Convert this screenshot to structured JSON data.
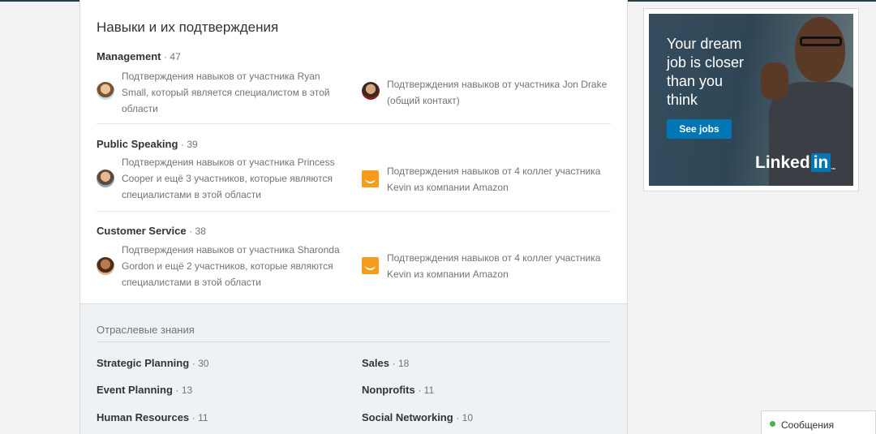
{
  "section": {
    "title": "Навыки и их подтверждения"
  },
  "skills": [
    {
      "name": "Management",
      "count": "· 47",
      "endorsements": [
        {
          "icon": "avatar",
          "lines": [
            "Подтверждения навыков от участника Ryan",
            "Small, который является специалистом в этой",
            "области"
          ]
        },
        {
          "icon": "avatar",
          "lines": [
            "Подтверждения навыков от участника Jon Drake",
            "(общий контакт)"
          ]
        }
      ]
    },
    {
      "name": "Public Speaking",
      "count": "· 39",
      "endorsements": [
        {
          "icon": "avatar",
          "lines": [
            "Подтверждения навыков от участника Princess",
            "Cooper и ещё 3 участников, которые являются",
            "специалистами в этой области"
          ]
        },
        {
          "icon": "amazon-logo-icon",
          "lines": [
            "Подтверждения навыков от 4 коллег участника",
            "Kevin из компании Amazon"
          ]
        }
      ]
    },
    {
      "name": "Customer Service",
      "count": "· 38",
      "endorsements": [
        {
          "icon": "avatar",
          "lines": [
            "Подтверждения навыков от участника Sharonda",
            "Gordon и ещё 2 участников, которые являются",
            "специалистами в этой области"
          ]
        },
        {
          "icon": "amazon-logo-icon",
          "lines": [
            "Подтверждения навыков от 4 коллег участника",
            "Kevin из компании Amazon"
          ]
        }
      ]
    }
  ],
  "industry": {
    "title": "Отраслевые знания",
    "items": [
      {
        "name": "Strategic Planning",
        "count": "· 30"
      },
      {
        "name": "Sales",
        "count": "· 18"
      },
      {
        "name": "Event Planning",
        "count": "· 13"
      },
      {
        "name": "Nonprofits",
        "count": "· 11"
      },
      {
        "name": "Human Resources",
        "count": "· 11"
      },
      {
        "name": "Social Networking",
        "count": "· 10"
      }
    ]
  },
  "ad": {
    "headline_lines": [
      "Your dream",
      "job is closer",
      "than you",
      "think"
    ],
    "button_label": "See jobs",
    "logo_text": "Linked",
    "logo_in": "in",
    "logo_tm": "™"
  },
  "messaging": {
    "label": "Сообщения",
    "status_color": "#46b44b"
  },
  "colors": {
    "brand": "#0077b5",
    "amazon": "#f59c1c"
  }
}
